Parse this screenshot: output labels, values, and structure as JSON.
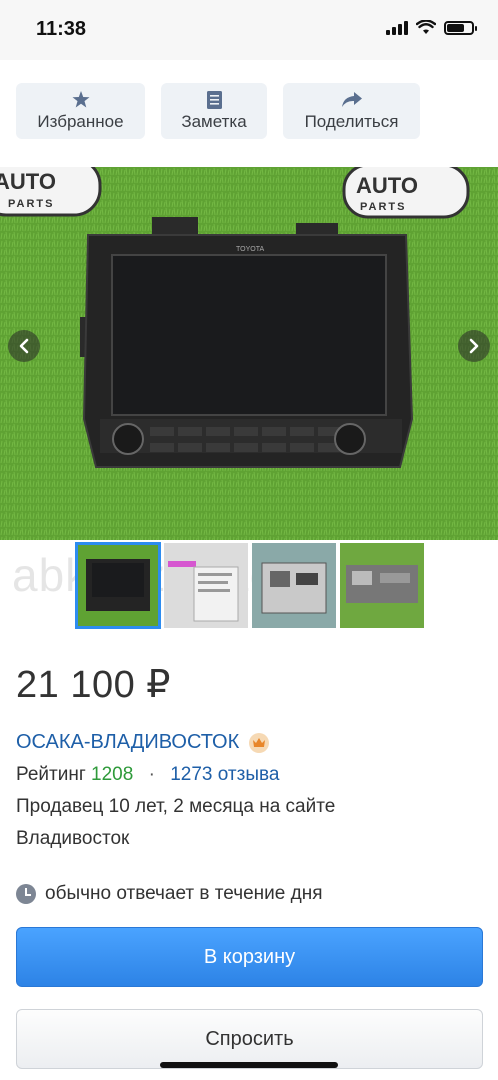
{
  "status_bar": {
    "time": "11:38",
    "battery_level": 0.7
  },
  "actions": {
    "favorite_label": "Избранное",
    "note_label": "Заметка",
    "share_label": "Поделиться"
  },
  "gallery": {
    "logo_line1": "AUTO",
    "logo_line2": "PARTS",
    "device_brand": "TOYOTA",
    "watermark": "abkhaz-auto.ru",
    "thumbnail_count": 4,
    "active_thumbnail": 1
  },
  "listing": {
    "price": "21 100 ₽",
    "seller_name": "ОСАКА-ВЛАДИВОСТОК",
    "rating_label": "Рейтинг",
    "rating_value": "1208",
    "reviews": "1273 отзыва",
    "seller_age": "Продавец 10 лет, 2 месяца на сайте",
    "city": "Владивосток",
    "response_time": "обычно отвечает в течение дня"
  },
  "buttons": {
    "cart": "В корзину",
    "ask": "Спросить"
  },
  "colors": {
    "link": "#1e5fa8",
    "rating": "#2e9a3a",
    "primary": "#2d83e6"
  }
}
